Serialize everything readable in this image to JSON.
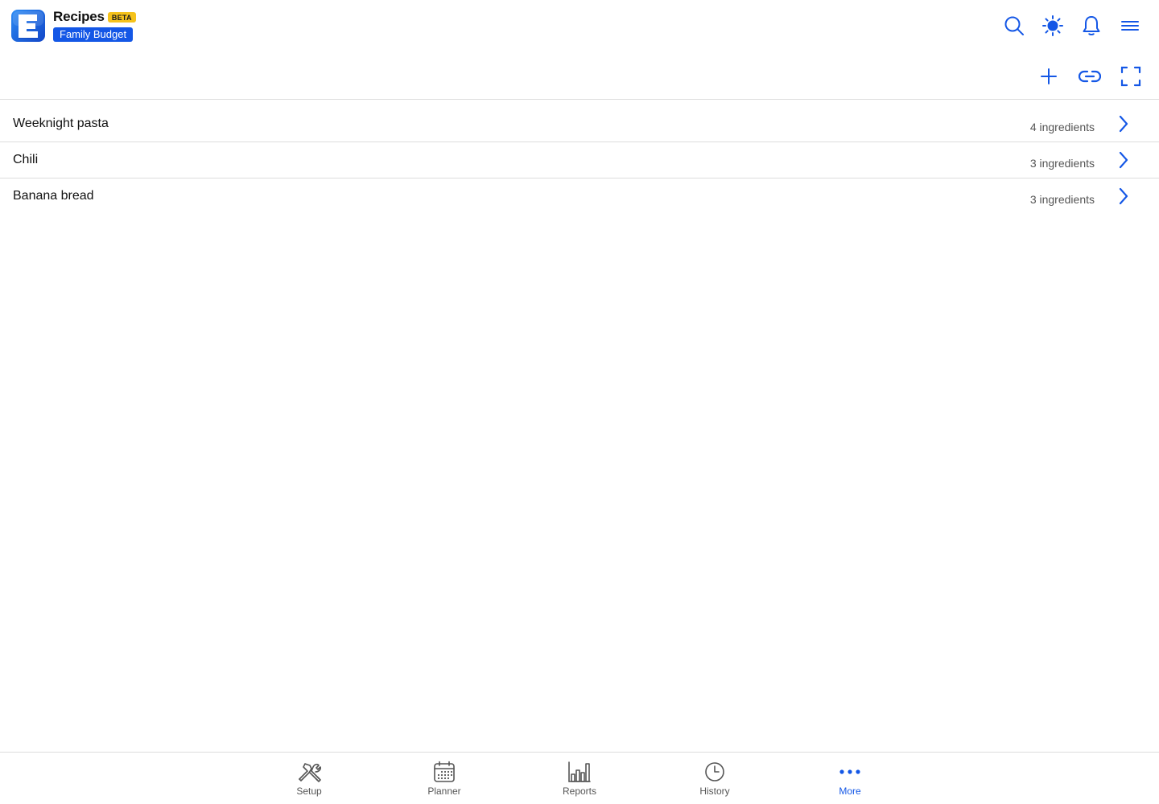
{
  "header": {
    "app_title": "Recipes",
    "beta_badge": "BETA",
    "budget_name": "Family Budget",
    "logo_letter": "E",
    "icons": [
      "search-icon",
      "sun-icon",
      "bell-icon",
      "hamburger-menu-icon"
    ]
  },
  "toolbar": {
    "icons": [
      "plus-icon",
      "link-icon",
      "fullscreen-icon"
    ]
  },
  "recipes": [
    {
      "name": "Weeknight pasta",
      "count": "4 ingredients"
    },
    {
      "name": "Chili",
      "count": "3 ingredients"
    },
    {
      "name": "Banana bread",
      "count": "3 ingredients"
    }
  ],
  "bottom_nav": [
    {
      "label": "Setup",
      "icon": "tools-icon",
      "active": false
    },
    {
      "label": "Planner",
      "icon": "calendar-icon",
      "active": false
    },
    {
      "label": "Reports",
      "icon": "bar-chart-icon",
      "active": false
    },
    {
      "label": "History",
      "icon": "clock-icon",
      "active": false
    },
    {
      "label": "More",
      "icon": "more-dots-icon",
      "active": true
    }
  ],
  "colors": {
    "accent": "#1457e6",
    "beta": "#f5c21b",
    "divider": "#dcdcdc",
    "muted_text": "#555555"
  }
}
